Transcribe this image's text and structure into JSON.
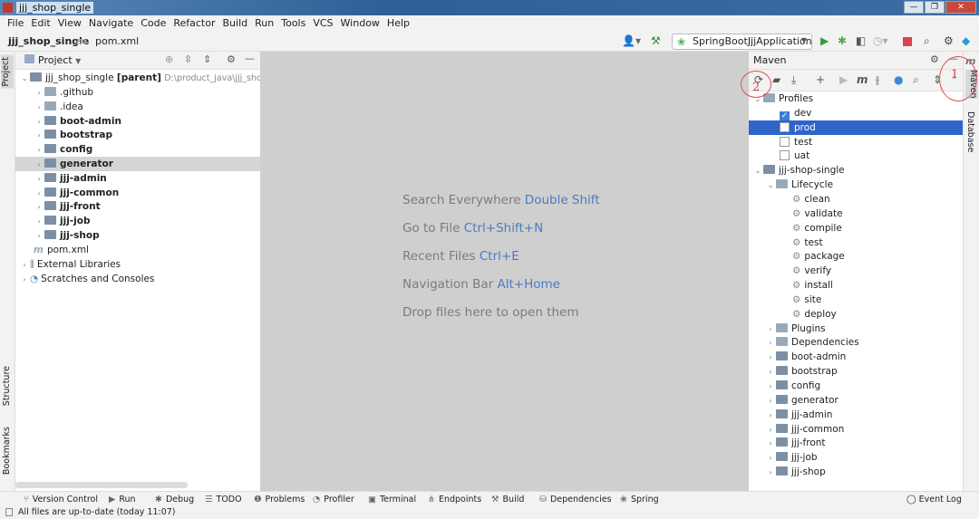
{
  "window": {
    "title": "jjj_shop_single",
    "controls": [
      "—",
      "❐",
      "✕"
    ]
  },
  "menu": [
    "File",
    "Edit",
    "View",
    "Navigate",
    "Code",
    "Refactor",
    "Build",
    "Run",
    "Tools",
    "VCS",
    "Window",
    "Help"
  ],
  "breadcrumb": {
    "project": "jjj_shop_single",
    "file": "pom.xml"
  },
  "run_config": "SpringBootJjjApplication",
  "project_panel": {
    "title": "Project",
    "root": {
      "name": "jjj_shop_single",
      "tag": "[parent]",
      "path": "D:\\product_java\\jjj_shop_si"
    },
    "items": [
      {
        "name": ".github",
        "bold": false
      },
      {
        "name": ".idea",
        "bold": false
      },
      {
        "name": "boot-admin",
        "bold": true
      },
      {
        "name": "bootstrap",
        "bold": true
      },
      {
        "name": "config",
        "bold": true
      },
      {
        "name": "generator",
        "bold": true,
        "selected": true
      },
      {
        "name": "jjj-admin",
        "bold": true
      },
      {
        "name": "jjj-common",
        "bold": true
      },
      {
        "name": "jjj-front",
        "bold": true
      },
      {
        "name": "jjj-job",
        "bold": true
      },
      {
        "name": "jjj-shop",
        "bold": true
      }
    ],
    "pom": "pom.xml",
    "external": "External Libraries",
    "scratches": "Scratches and Consoles"
  },
  "editor_hints": [
    {
      "text": "Search Everywhere",
      "key": "Double Shift"
    },
    {
      "text": "Go to File",
      "key": "Ctrl+Shift+N"
    },
    {
      "text": "Recent Files",
      "key": "Ctrl+E"
    },
    {
      "text": "Navigation Bar",
      "key": "Alt+Home"
    },
    {
      "text": "Drop files here to open them",
      "key": ""
    }
  ],
  "maven": {
    "title": "Maven",
    "profiles_label": "Profiles",
    "profiles": [
      {
        "name": "dev",
        "checked": true
      },
      {
        "name": "prod",
        "checked": false,
        "selected": true
      },
      {
        "name": "test",
        "checked": false
      },
      {
        "name": "uat",
        "checked": false
      }
    ],
    "project": "jjj-shop-single",
    "lifecycle_label": "Lifecycle",
    "lifecycle": [
      "clean",
      "validate",
      "compile",
      "test",
      "package",
      "verify",
      "install",
      "site",
      "deploy"
    ],
    "plugins": "Plugins",
    "dependencies": "Dependencies",
    "modules": [
      "boot-admin",
      "bootstrap",
      "config",
      "generator",
      "jjj-admin",
      "jjj-common",
      "jjj-front",
      "jjj-job",
      "jjj-shop"
    ]
  },
  "left_tabs": [
    "Project",
    "Structure",
    "Bookmarks"
  ],
  "right_tabs": [
    "Maven",
    "Database"
  ],
  "bottom_tabs": [
    "Version Control",
    "Run",
    "Debug",
    "TODO",
    "Problems",
    "Profiler",
    "Terminal",
    "Endpoints",
    "Build",
    "Dependencies",
    "Spring"
  ],
  "event_log": "Event Log",
  "status": "All files are up-to-date (today 11:07)",
  "annotations": [
    "1",
    "2"
  ],
  "colors": {
    "selection": "#2f65ca",
    "editor_bg": "#cfcfcf",
    "annotation": "#e04040"
  }
}
